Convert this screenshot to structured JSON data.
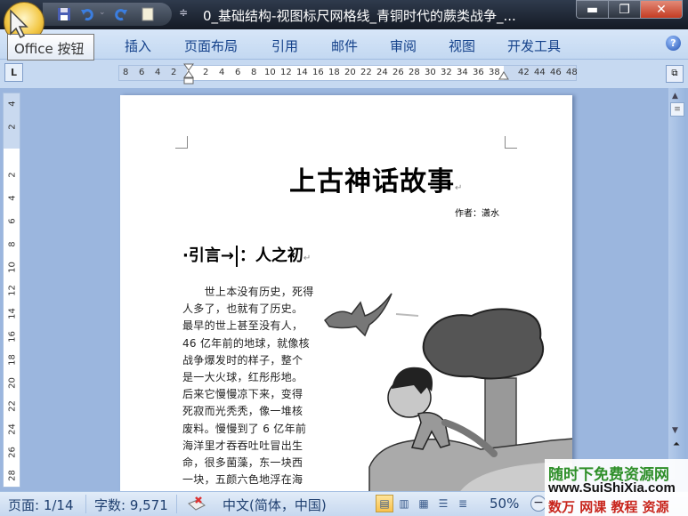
{
  "titlebar": {
    "title": "0_基础结构-视图标尺网格线_青铜时代的蕨类战争_...",
    "qat_icons": [
      "save-icon",
      "undo-icon",
      "redo-icon",
      "new-doc-icon"
    ],
    "minimize": "▬",
    "restore": "❐",
    "close": "✕"
  },
  "tooltip": {
    "text": "Office 按钮"
  },
  "ribbon": {
    "tabs": [
      {
        "label": "插入"
      },
      {
        "label": "页面布局"
      },
      {
        "label": "引用"
      },
      {
        "label": "邮件"
      },
      {
        "label": "审阅"
      },
      {
        "label": "视图"
      },
      {
        "label": "开发工具"
      }
    ],
    "help": "?"
  },
  "ruler": {
    "tab_selector": "L",
    "left_numbers": [
      "8",
      "6",
      "4",
      "2"
    ],
    "numbers": [
      "2",
      "4",
      "6",
      "8",
      "10",
      "12",
      "14",
      "16",
      "18",
      "20",
      "22",
      "24",
      "26",
      "28",
      "30",
      "32",
      "34",
      "36",
      "38"
    ],
    "right_numbers": [
      "42",
      "44",
      "46",
      "48"
    ],
    "vertical_top_numbers": [
      "4",
      "2"
    ],
    "vertical_numbers": [
      "2",
      "4",
      "6",
      "8",
      "10",
      "12",
      "14",
      "16",
      "18",
      "20",
      "22",
      "24",
      "26",
      "28"
    ]
  },
  "document": {
    "title": "上古神话故事",
    "author": "作者：潇水",
    "section_prefix": "·引言→",
    "section_title": "：人之初",
    "paragraph_mark": "↵",
    "body_lines": [
      "　　世上本没有历史，死得",
      "人多了，也就有了历史。",
      "最早的世上甚至没有人，",
      "46 亿年前的地球，就像核",
      "战争爆发时的样子，整个",
      "是一大火球，红彤彤地。",
      "后来它慢慢凉下来，变得",
      "死寂而光秃秃，像一堆核",
      "废料。慢慢到了 6 亿年前",
      "海洋里才吞吞吐吐冒出生",
      "命，很多菌藻，东一块西",
      "一块，五颜六色地浮在海"
    ]
  },
  "statusbar": {
    "page": "页面: 1/14",
    "words": "字数: 9,571",
    "language": "中文(简体，中国)",
    "zoom": "50%",
    "view_buttons": [
      "print-layout",
      "full-screen-reading",
      "web-layout",
      "outline",
      "draft"
    ]
  },
  "watermark": {
    "line1": "随时下免费资源网",
    "line2": "www.SuiShiXia.com",
    "line3": "数万 网课 教程 资源"
  },
  "colors": {
    "titlebar": "#1e2632",
    "ribbon_tab_text": "#15428b",
    "workspace": "#9bb6de",
    "watermark_green": "#2f8f2a",
    "watermark_red": "#c8261d"
  }
}
